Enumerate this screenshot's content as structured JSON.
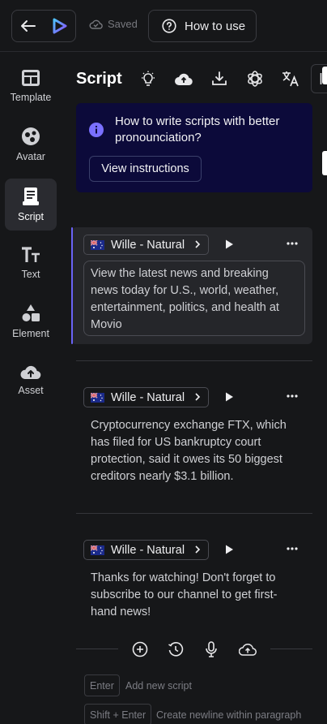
{
  "topbar": {
    "saved_label": "Saved",
    "howto_label": "How to use"
  },
  "sidebar": {
    "items": [
      {
        "label": "Template",
        "icon": "template-icon"
      },
      {
        "label": "Avatar",
        "icon": "avatar-icon"
      },
      {
        "label": "Script",
        "icon": "script-icon",
        "active": true
      },
      {
        "label": "Text",
        "icon": "text-icon"
      },
      {
        "label": "Element",
        "icon": "element-icon"
      },
      {
        "label": "Asset",
        "icon": "asset-icon"
      }
    ]
  },
  "script": {
    "title": "Script",
    "toolbar_icons": [
      "bulb-icon",
      "cloud-upload-icon",
      "download-icon",
      "openai-icon",
      "translate-icon",
      "collapse-panel-icon"
    ]
  },
  "banner": {
    "text": "How to write scripts with better pronounciation?",
    "button": "View instructions"
  },
  "paragraphs": [
    {
      "voice": "Wille - Natural",
      "text": "View the latest news and breaking news today for U.S., world, weather, entertainment, politics, and health at Movio"
    },
    {
      "voice": "Wille - Natural",
      "text": "Cryptocurrency exchange FTX, which has filed for US bankruptcy court protection, said it owes its 50 biggest creditors nearly $3.1 billion."
    },
    {
      "voice": "Wille - Natural",
      "text": "Thanks for watching! Don't forget to subscribe to our channel to get first-hand news!"
    }
  ],
  "hints": {
    "enter_key": "Enter",
    "enter_hint": "Add new script",
    "shift_key": "Shift + Enter",
    "shift_hint": "Create newline within paragraph"
  },
  "colors": {
    "accent": "#6a63f6",
    "banner_bg": "#0c0a3a",
    "background": "#161719"
  }
}
